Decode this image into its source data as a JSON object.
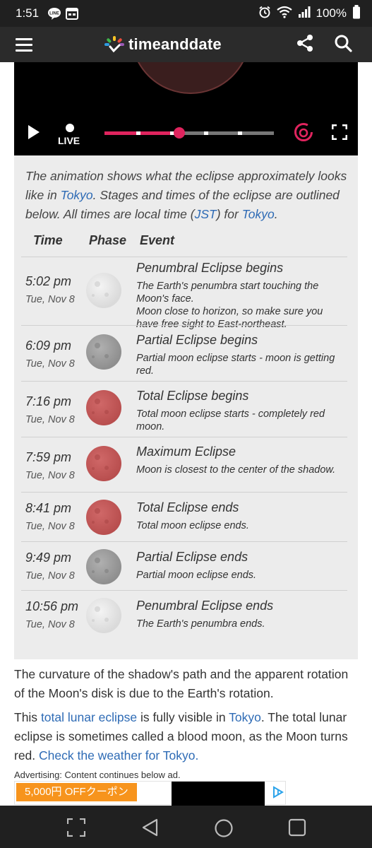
{
  "status_bar": {
    "time": "1:51",
    "line_badge": "LINE",
    "battery": "100%"
  },
  "header": {
    "site_name": "timeanddate",
    "icons": [
      "menu-icon",
      "logo-icon",
      "share-icon",
      "search-icon"
    ]
  },
  "video": {
    "live_label": "LIVE",
    "progress": 0.44
  },
  "intro": {
    "text1": "The animation shows what the eclipse approximately looks like in ",
    "link1": "Tokyo",
    "text2": ". Stages and times of the eclipse are outlined below. All times are local time (",
    "link2": "JST",
    "text3": ") for ",
    "link3": "Tokyo",
    "text4": "."
  },
  "table": {
    "headers": [
      "Time",
      "Phase",
      "Event"
    ],
    "rows": [
      {
        "time": "5:02 pm",
        "date": "Tue, Nov 8",
        "phase": "penumbral",
        "event": "Penumbral Eclipse begins",
        "desc": "The Earth's penumbra start touching the Moon's face.",
        "desc2": "Moon close to horizon, so make sure you have free sight to East-northeast."
      },
      {
        "time": "6:09 pm",
        "date": "Tue, Nov 8",
        "phase": "partial",
        "event": "Partial Eclipse begins",
        "desc": "Partial moon eclipse starts - moon is getting red."
      },
      {
        "time": "7:16 pm",
        "date": "Tue, Nov 8",
        "phase": "total",
        "event": "Total Eclipse begins",
        "desc": "Total moon eclipse starts - completely red moon."
      },
      {
        "time": "7:59 pm",
        "date": "Tue, Nov 8",
        "phase": "total",
        "event": "Maximum Eclipse",
        "desc": "Moon is closest to the center of the shadow."
      },
      {
        "time": "8:41 pm",
        "date": "Tue, Nov 8",
        "phase": "total",
        "event": "Total Eclipse ends",
        "desc": "Total moon eclipse ends."
      },
      {
        "time": "9:49 pm",
        "date": "Tue, Nov 8",
        "phase": "partial",
        "event": "Partial Eclipse ends",
        "desc": "Partial moon eclipse ends."
      },
      {
        "time": "10:56 pm",
        "date": "Tue, Nov 8",
        "phase": "penumbral",
        "event": "Penumbral Eclipse ends",
        "desc": "The Earth's penumbra ends."
      }
    ]
  },
  "body": {
    "para1": "The curvature of the shadow's path and the apparent rotation of the Moon's disk is due to the Earth's rotation.",
    "para2_a": "This ",
    "para2_link1": "total lunar eclipse",
    "para2_b": " is fully visible in ",
    "para2_link2": "Tokyo",
    "para2_c": ". The total lunar eclipse is sometimes called a blood moon, as the Moon turns red. ",
    "para2_link3": "Check the weather for Tokyo."
  },
  "ad": {
    "note": "Advertising: Content continues below ad.",
    "coupon": "5,000円 OFFクーポン"
  },
  "colors": {
    "accent_red": "#e0245e",
    "link_blue": "#2e6bb5",
    "header_bg": "#2b2b2b",
    "panel_bg": "#ececec"
  }
}
